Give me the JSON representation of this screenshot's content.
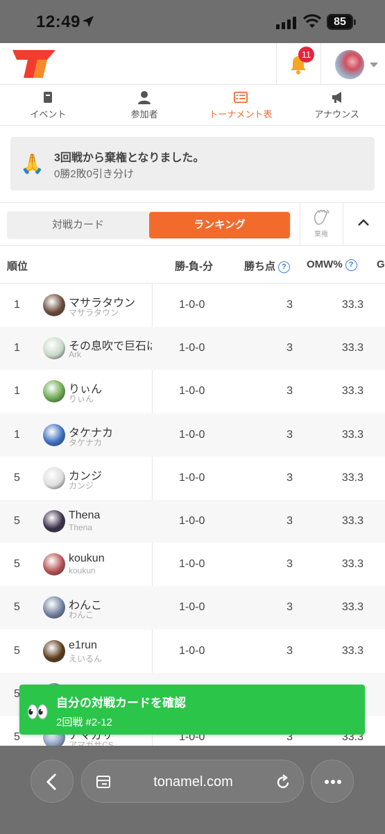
{
  "status_bar": {
    "time": "12:49",
    "battery": "85"
  },
  "header": {
    "notification_count": "11"
  },
  "nav_tabs": [
    {
      "label": "イベント",
      "icon": "event-icon",
      "active": false
    },
    {
      "label": "参加者",
      "icon": "person-icon",
      "active": false
    },
    {
      "label": "トーナメント表",
      "icon": "bracket-icon",
      "active": true
    },
    {
      "label": "アナウンス",
      "icon": "megaphone-icon",
      "active": false
    }
  ],
  "notice": {
    "title": "3回戦から棄権となりました。",
    "record": "0勝2敗0引き分け"
  },
  "view_toggle": {
    "match_cards": "対戦カード",
    "ranking": "ランキング",
    "forfeit": "棄権"
  },
  "table": {
    "headers": {
      "rank": "順位",
      "record": "勝-負-分",
      "points": "勝ち点",
      "omw": "OMW%",
      "extra": "G"
    },
    "rows": [
      {
        "rank": "1",
        "name": "マサラタウン",
        "sub": "マサラタウン",
        "record": "1-0-0",
        "points": "3",
        "omw": "33.3"
      },
      {
        "rank": "1",
        "name": "その息吹で巨石は",
        "sub": "Ark",
        "record": "1-0-0",
        "points": "3",
        "omw": "33.3"
      },
      {
        "rank": "1",
        "name": "りぃん",
        "sub": "りぃん",
        "record": "1-0-0",
        "points": "3",
        "omw": "33.3"
      },
      {
        "rank": "1",
        "name": "タケナカ",
        "sub": "タケナカ",
        "record": "1-0-0",
        "points": "3",
        "omw": "33.3"
      },
      {
        "rank": "5",
        "name": "カンジ",
        "sub": "カンジ",
        "record": "1-0-0",
        "points": "3",
        "omw": "33.3"
      },
      {
        "rank": "5",
        "name": "Thena",
        "sub": "Thena",
        "record": "1-0-0",
        "points": "3",
        "omw": "33.3"
      },
      {
        "rank": "5",
        "name": "koukun",
        "sub": "koukun",
        "record": "1-0-0",
        "points": "3",
        "omw": "33.3"
      },
      {
        "rank": "5",
        "name": "わんこ",
        "sub": "わんこ",
        "record": "1-0-0",
        "points": "3",
        "omw": "33.3"
      },
      {
        "rank": "5",
        "name": "e1run",
        "sub": "えいるん",
        "record": "1-0-0",
        "points": "3",
        "omw": "33.3"
      },
      {
        "rank": "5",
        "name": "",
        "sub": "",
        "record": "",
        "points": "",
        "omw": ""
      },
      {
        "rank": "5",
        "name": "アマガサ",
        "sub": "アマガサCS",
        "record": "1-0-0",
        "points": "3",
        "omw": "33.3"
      }
    ]
  },
  "banner": {
    "title": "自分の対戦カードを確認",
    "subtitle": "2回戦 #2-12"
  },
  "browser": {
    "url": "tonamel.com"
  },
  "colors": {
    "accent": "#f36a2d",
    "green": "#2bc54a",
    "link_blue": "#3b82d8"
  }
}
